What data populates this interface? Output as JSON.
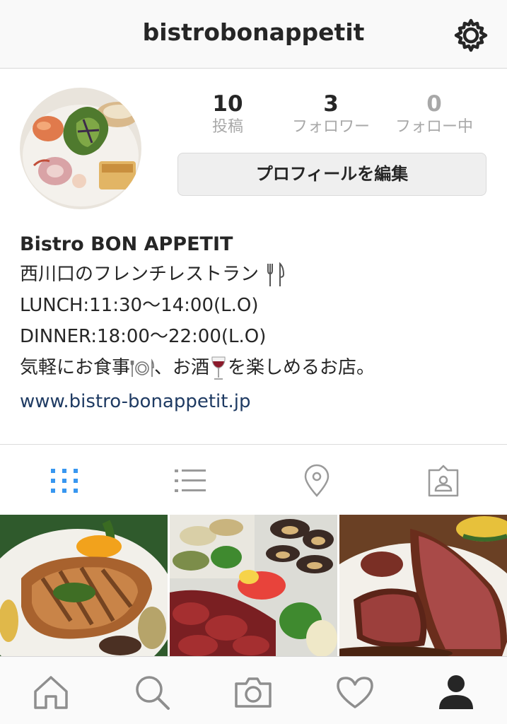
{
  "header": {
    "username": "bistrobonappetit",
    "settings_icon": "gear-icon"
  },
  "stats": {
    "posts": {
      "count": "10",
      "label": "投稿"
    },
    "followers": {
      "count": "3",
      "label": "フォロワー"
    },
    "following": {
      "count": "0",
      "label": "フォロー中"
    }
  },
  "edit_profile_label": "プロフィールを編集",
  "bio": {
    "name": "Bistro BON APPETIT",
    "line1": "西川口のフレンチレストラン",
    "line2": "LUNCH:11:30〜14:00(L.O)",
    "line3": "DINNER:18:00〜22:00(L.O)",
    "line4_a": "気軽にお食事",
    "line4_b": "、お酒",
    "line4_c": "を楽しめるお店。",
    "website": "www.bistro-bonappetit.jp"
  },
  "tabs": [
    "grid-icon",
    "list-icon",
    "location-pin-icon",
    "tagged-person-icon"
  ],
  "nav": [
    "home-icon",
    "search-icon",
    "camera-icon",
    "heart-icon",
    "profile-icon"
  ],
  "colors": {
    "accent": "#3897f0",
    "link": "#1f3b63",
    "muted": "#a8a8a8",
    "wine": "#8b1a2b"
  }
}
